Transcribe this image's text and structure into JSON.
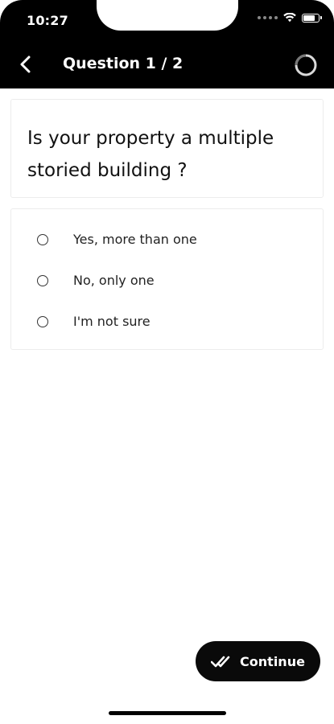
{
  "status_bar": {
    "time": "10:27",
    "battery_level": 0.85
  },
  "header": {
    "title": "Question 1 / 2",
    "back_icon": "chevron-left-icon",
    "progress_icon": "progress-ring-icon"
  },
  "question": {
    "text": "Is your property a multiple storied building ?"
  },
  "options": [
    {
      "label": "Yes, more than one",
      "selected": false
    },
    {
      "label": "No, only one",
      "selected": false
    },
    {
      "label": "I'm not sure",
      "selected": false
    }
  ],
  "continue_button": {
    "label": "Continue",
    "icon": "double-check-icon"
  },
  "colors": {
    "header_bg": "#000000",
    "button_bg": "#0a0a0a",
    "card_border": "#ececec"
  }
}
